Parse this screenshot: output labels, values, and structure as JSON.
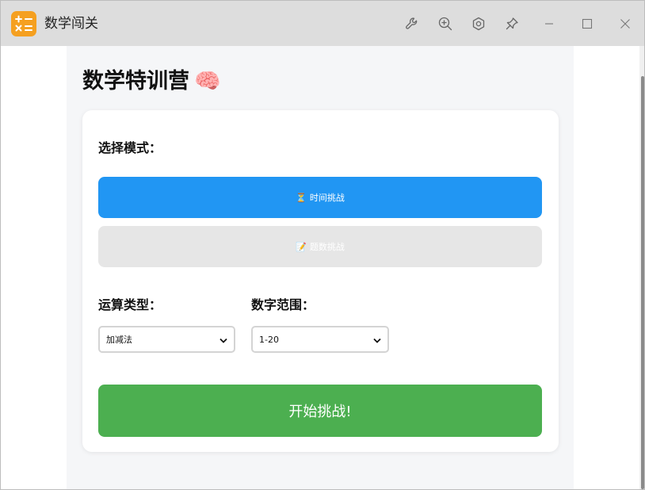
{
  "window": {
    "title": "数学闯关",
    "app_icon": "calculator-icon",
    "toolbar_icons": [
      "wrench-icon",
      "zoom-in-icon",
      "hexagon-settings-icon",
      "pin-icon"
    ],
    "controls": [
      "minimize-icon",
      "maximize-icon",
      "close-icon"
    ]
  },
  "page": {
    "title": "数学特训营",
    "title_emoji": "🧠"
  },
  "mode": {
    "label": "选择模式：",
    "buttons": [
      {
        "icon": "⏳",
        "label": "时间挑战",
        "active": true
      },
      {
        "icon": "📝",
        "label": "题数挑战",
        "active": false
      }
    ]
  },
  "operation": {
    "label": "运算类型：",
    "selected": "加减法"
  },
  "range": {
    "label": "数字范围：",
    "selected": "1-20"
  },
  "start_button": "开始挑战!",
  "colors": {
    "primary": "#2196f3",
    "start": "#4caf50",
    "app_icon": "#f5a020",
    "inactive": "#e6e6e6"
  }
}
